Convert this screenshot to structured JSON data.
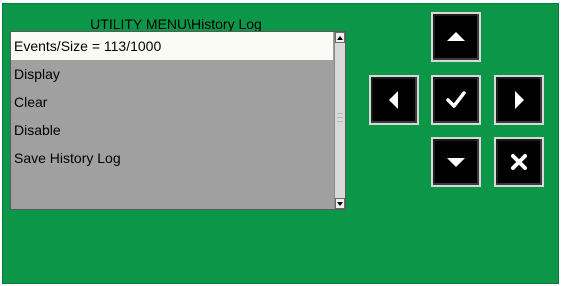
{
  "window": {
    "title": "UTILITY MENU\\History Log"
  },
  "menu": {
    "items": [
      {
        "label": "Events/Size = 113/1000",
        "selected": true
      },
      {
        "label": "Display",
        "selected": false
      },
      {
        "label": "Clear",
        "selected": false
      },
      {
        "label": "Disable",
        "selected": false
      },
      {
        "label": "Save History Log",
        "selected": false
      }
    ]
  },
  "keypad": {
    "up": "up-arrow-icon",
    "left": "left-arrow-icon",
    "enter": "checkmark-icon",
    "right": "right-arrow-icon",
    "down": "down-arrow-icon",
    "cancel": "x-icon"
  },
  "colors": {
    "panel_background": "#0c9648",
    "list_background": "#a0a0a0",
    "selected_item": "#fbfbf5",
    "key_face": "#000000",
    "key_glyph": "#ffffff"
  }
}
